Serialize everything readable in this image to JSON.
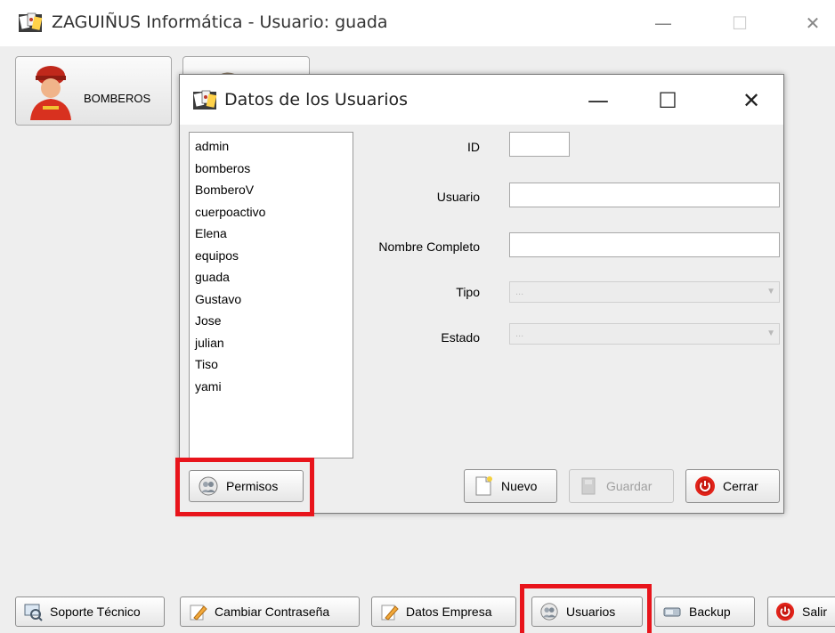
{
  "window": {
    "title": "ZAGUIÑUS Informática - Usuario: guada",
    "icon": "app-cards-icon"
  },
  "main_buttons": {
    "bomberos_label": "BOMBEROS"
  },
  "dialog": {
    "title": "Datos de los Usuarios",
    "users": [
      "admin",
      "bomberos",
      "BomberoV",
      "cuerpoactivo",
      "Elena",
      "equipos",
      "guada",
      "Gustavo",
      "Jose",
      "julian",
      "Tiso",
      "yami"
    ],
    "fields": {
      "id_label": "ID",
      "id_value": "",
      "usuario_label": "Usuario",
      "usuario_value": "",
      "nombre_label": "Nombre Completo",
      "nombre_value": "",
      "tipo_label": "Tipo",
      "tipo_value": "...",
      "estado_label": "Estado",
      "estado_value": "..."
    },
    "buttons": {
      "permisos": "Permisos",
      "nuevo": "Nuevo",
      "guardar": "Guardar",
      "cerrar": "Cerrar"
    }
  },
  "bottom_bar": {
    "soporte": "Soporte Técnico",
    "cambiar": "Cambiar Contraseña",
    "datos_empresa": "Datos Empresa",
    "usuarios": "Usuarios",
    "backup": "Backup",
    "salir": "Salir"
  },
  "colors": {
    "highlight": "#e8141b",
    "background": "#eeeeee"
  }
}
